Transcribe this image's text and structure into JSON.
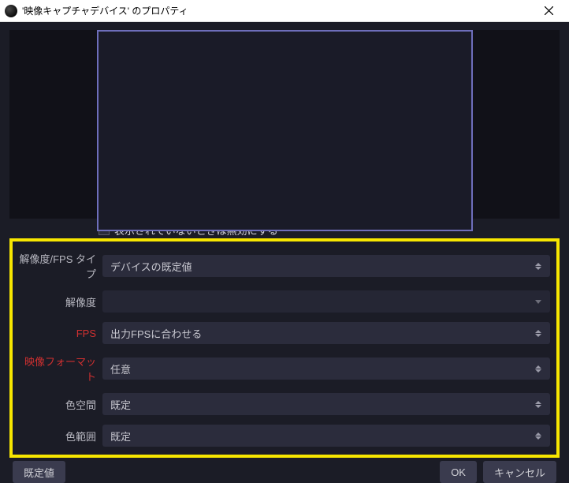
{
  "window": {
    "title": "'映像キャプチャデバイス' のプロパティ"
  },
  "checkbox": {
    "deactivate_when_hidden": "表示されていないときは無効にする"
  },
  "form": {
    "res_fps_type": {
      "label": "解像度/FPS タイプ",
      "value": "デバイスの既定値"
    },
    "resolution": {
      "label": "解像度",
      "value": ""
    },
    "fps": {
      "label": "FPS",
      "value": "出力FPSに合わせる"
    },
    "video_format": {
      "label": "映像フォーマット",
      "value": "任意"
    },
    "color_space": {
      "label": "色空間",
      "value": "既定"
    },
    "color_range": {
      "label": "色範囲",
      "value": "既定"
    }
  },
  "buttons": {
    "defaults": "既定値",
    "ok": "OK",
    "cancel": "キャンセル"
  }
}
